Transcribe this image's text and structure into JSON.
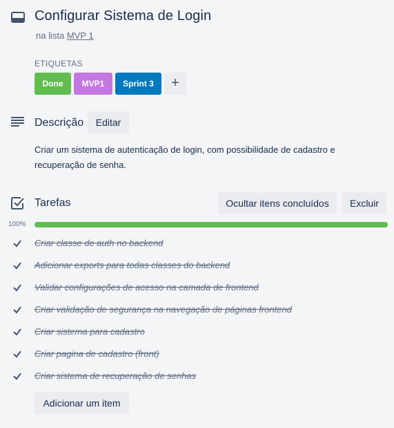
{
  "card": {
    "title": "Configurar Sistema de Login",
    "in_list_prefix": "na lista",
    "list_name": "MVP 1"
  },
  "labels": {
    "heading": "ETIQUETAS",
    "items": [
      {
        "text": "Done",
        "color": "#61bd4f"
      },
      {
        "text": "MVP1",
        "color": "#c377e0"
      },
      {
        "text": "Sprint 3",
        "color": "#0079bf"
      }
    ],
    "add_symbol": "+"
  },
  "description": {
    "title": "Descrição",
    "edit_label": "Editar",
    "text": "Criar um sistema de autenticação de login, com possibilidade de cadastro e recuperação de senha."
  },
  "checklist": {
    "title": "Tarefas",
    "hide_completed_label": "Ocultar itens concluídos",
    "delete_label": "Excluir",
    "progress_label": "100%",
    "progress": 1.0,
    "items": [
      {
        "text": "Criar classe de auth no backend",
        "done": true
      },
      {
        "text": "Adicionar exports para todas classes do backend",
        "done": true
      },
      {
        "text": "Validar configurações de acesso na camada de frontend",
        "done": true
      },
      {
        "text": "Criar validação de segurança na navegação de páginas frontend",
        "done": true
      },
      {
        "text": "Criar sistema para cadastro",
        "done": true
      },
      {
        "text": "Criar pagina de cadastro (front)",
        "done": true
      },
      {
        "text": "Criar sistema de recuperação de senhas",
        "done": true
      }
    ],
    "add_item_label": "Adicionar um item"
  },
  "colors": {
    "background": "#f4f5f7",
    "text_primary": "#172b4d",
    "text_muted": "#5e6c84",
    "button_bg": "#ebecf0",
    "progress_complete": "#61bd4f"
  },
  "icons": {
    "card": "card-icon",
    "description": "description-lines-icon",
    "checklist": "checklist-icon",
    "item_check": "checkmark-icon"
  }
}
